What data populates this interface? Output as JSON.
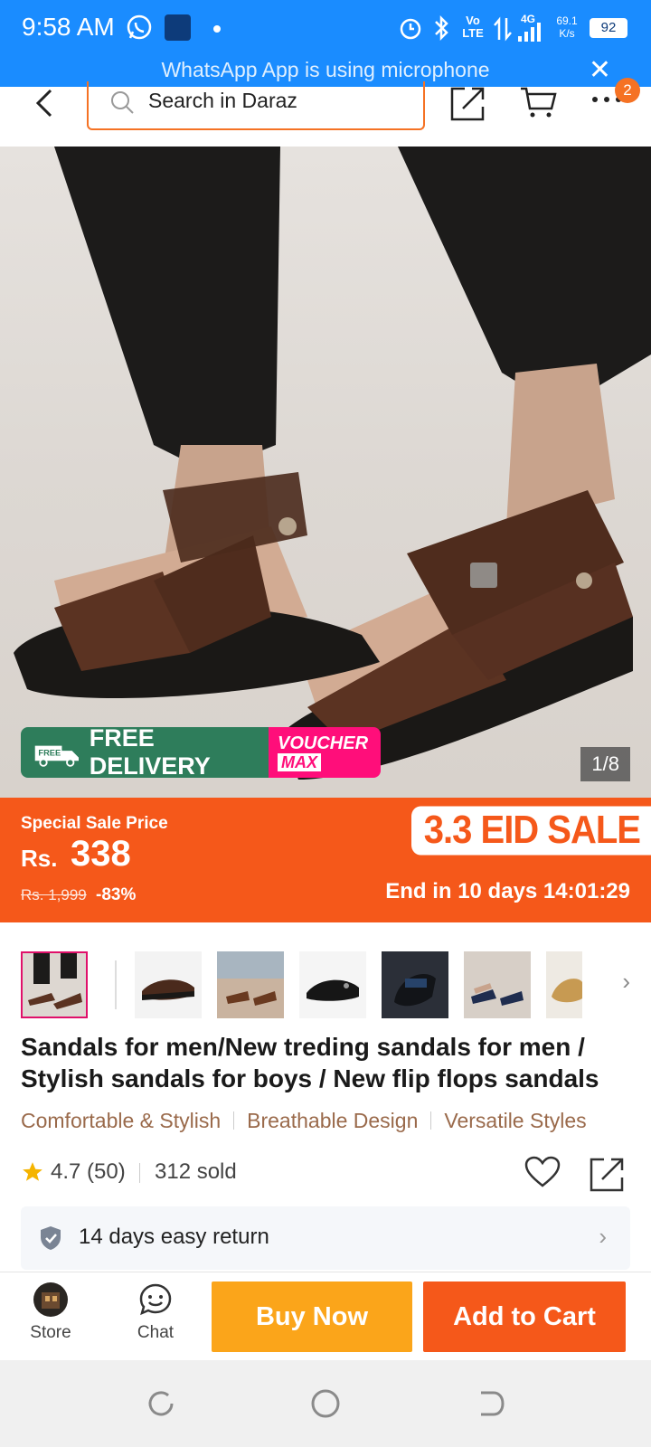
{
  "status_bar": {
    "time": "9:58 AM",
    "network_label_volte": "Vo LTE",
    "network_label_4g": "4G",
    "speed_value": "69.1",
    "speed_unit": "K/s",
    "battery": "92",
    "icons": [
      "whatsapp-icon",
      "app-square-icon",
      "dot-icon",
      "alarm-icon",
      "bluetooth-icon",
      "volte-icon",
      "data-arrows-icon",
      "signal-icon",
      "battery-icon"
    ]
  },
  "notification": {
    "text": "WhatsApp App is using microphone",
    "close_icon": "close-icon"
  },
  "header": {
    "search_placeholder": "Search in Daraz",
    "cart_badge": "2",
    "icons": [
      "back-icon",
      "search-icon",
      "share-icon",
      "cart-icon",
      "more-icon"
    ]
  },
  "gallery": {
    "counter": "1/8",
    "promo_free_small": "FREE",
    "promo_free_delivery": "FREE DELIVERY",
    "promo_voucher": "VOUCHER",
    "promo_max": "MAX"
  },
  "price": {
    "label": "Special Sale Price",
    "currency": "Rs.",
    "amount": "338",
    "original": "Rs. 1,999",
    "discount": "-83%",
    "campaign": "3.3 EID SALE",
    "ends": "End in 10 days 14:01:29",
    "colors": {
      "band": "#f5581a",
      "accent": "#f57224"
    }
  },
  "thumbnails": [
    "thumb-1",
    "thumb-2",
    "thumb-3",
    "thumb-4",
    "thumb-5",
    "thumb-6",
    "thumb-7"
  ],
  "product": {
    "title": "Sandals for men/New treding sandals for men / Stylish sandals for boys / New flip flops sandals",
    "tags": [
      "Comfortable & Stylish",
      "Breathable Design",
      "Versatile Styles"
    ],
    "rating": "4.7",
    "rating_count": "(50)",
    "sold": "312 sold",
    "return_policy": "14 days easy return"
  },
  "action_bar": {
    "store_label": "Store",
    "chat_label": "Chat",
    "buy_now": "Buy Now",
    "add_to_cart": "Add to Cart",
    "colors": {
      "buy": "#fba51a",
      "cart": "#f5581a"
    }
  },
  "system_nav": [
    "recents-icon",
    "home-icon",
    "back-nav-icon"
  ]
}
